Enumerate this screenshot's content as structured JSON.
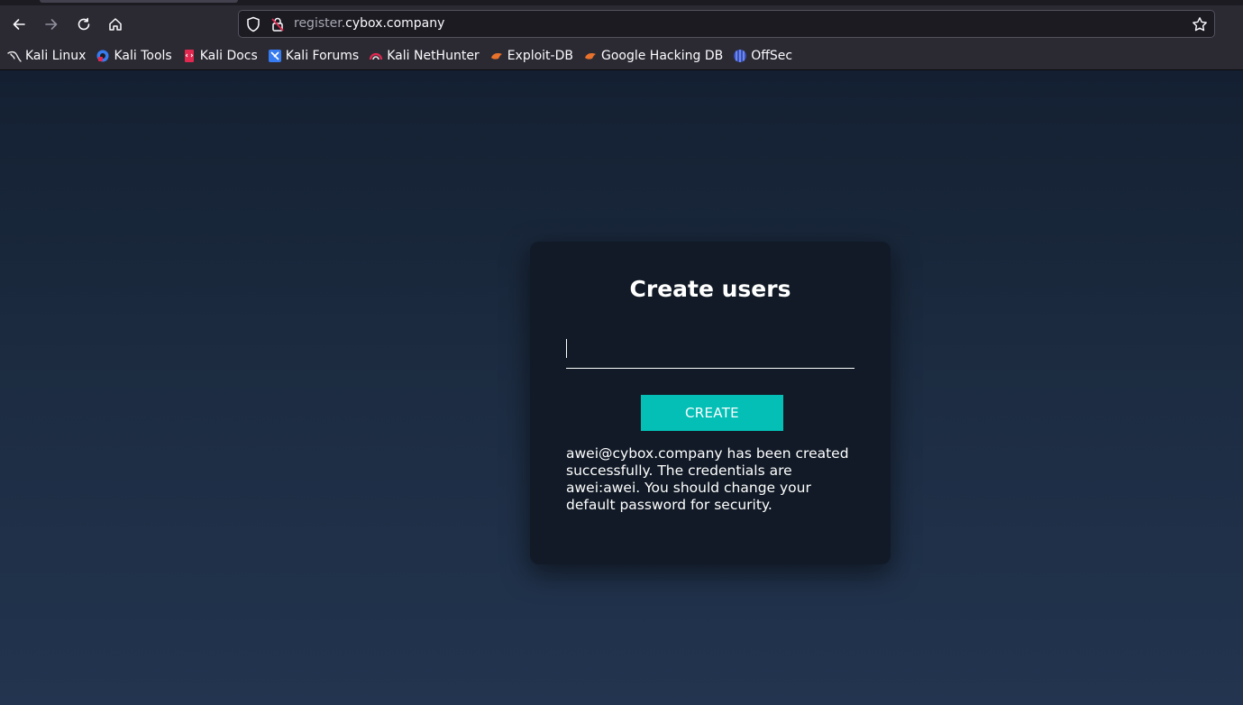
{
  "browser": {
    "url_subdomain": "register.",
    "url_domain": "cybox.company",
    "bookmarks": [
      {
        "label": "Kali Linux",
        "icon": "kali-dragon-icon"
      },
      {
        "label": "Kali Tools",
        "icon": "kali-tools-icon"
      },
      {
        "label": "Kali Docs",
        "icon": "kali-docs-icon"
      },
      {
        "label": "Kali Forums",
        "icon": "kali-forums-icon"
      },
      {
        "label": "Kali NetHunter",
        "icon": "kali-nethunter-icon"
      },
      {
        "label": "Exploit-DB",
        "icon": "exploit-db-icon"
      },
      {
        "label": "Google Hacking DB",
        "icon": "ghdb-icon"
      },
      {
        "label": "OffSec",
        "icon": "offsec-icon"
      }
    ]
  },
  "form": {
    "title": "Create users",
    "input_value": "",
    "button_label": "CREATE",
    "message": "awei@cybox.company has been created successfully. The credentials are awei:awei. You should change your default password for security."
  },
  "colors": {
    "accent": "#03bfb6",
    "card_bg": "#111a26",
    "chrome_bg": "#2b2a33"
  }
}
